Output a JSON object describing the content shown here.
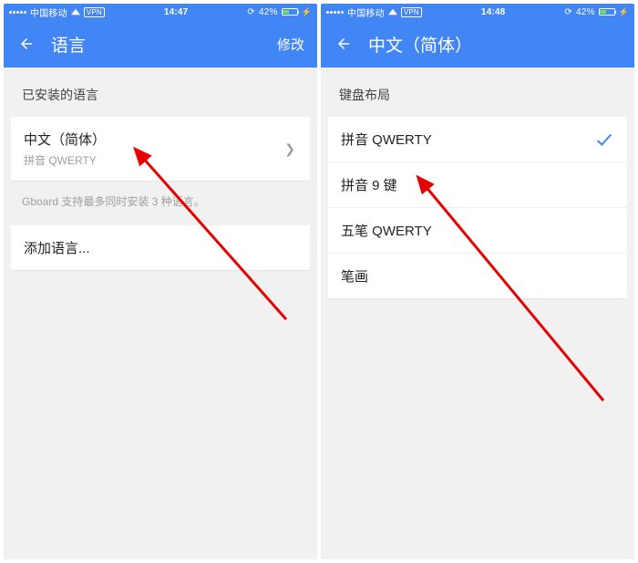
{
  "colors": {
    "primary": "#4285f4"
  },
  "left": {
    "statusbar": {
      "carrier": "中国移动",
      "vpn": "VPN",
      "time": "14:47",
      "battery_pct": "42%"
    },
    "appbar": {
      "title": "语言",
      "action": "修改"
    },
    "section_label": "已安装的语言",
    "installed": {
      "primary": "中文（简体）",
      "secondary": "拼音 QWERTY"
    },
    "note": "Gboard 支持最多同时安装 3 种语言。",
    "add_row": "添加语言..."
  },
  "right": {
    "statusbar": {
      "carrier": "中国移动",
      "vpn": "VPN",
      "time": "14:48",
      "battery_pct": "42%"
    },
    "appbar": {
      "title": "中文（简体）"
    },
    "section_label": "键盘布局",
    "layouts": [
      {
        "label": "拼音 QWERTY",
        "selected": true
      },
      {
        "label": "拼音 9 键",
        "selected": false
      },
      {
        "label": "五笔 QWERTY",
        "selected": false
      },
      {
        "label": "笔画",
        "selected": false
      }
    ]
  }
}
